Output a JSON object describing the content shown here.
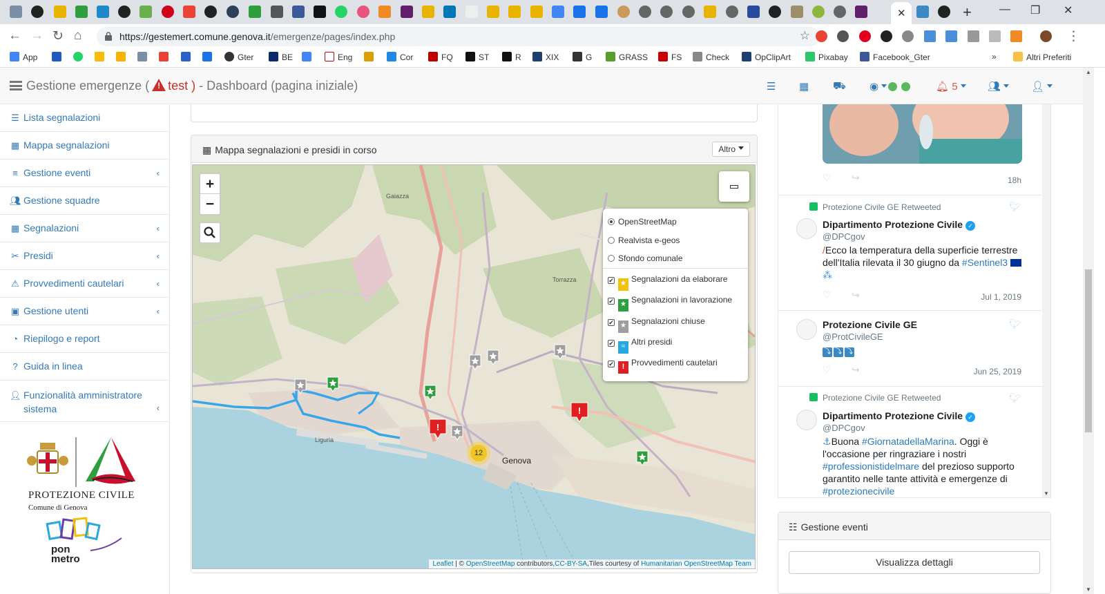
{
  "browser": {
    "url_host": "https://gestemert.comune.genova.it",
    "url_path": "/emergenze/pages/index.php",
    "bookmarks": [
      "App",
      "Gter",
      "BE",
      "Eng",
      "Cor",
      "FQ",
      "ST",
      "R",
      "XIX",
      "G",
      "GRASS",
      "FS",
      "Check",
      "OpClipArt",
      "Pixabay",
      "Facebook_Gter",
      "Altri Preferiti"
    ]
  },
  "header": {
    "title_prefix": "Gestione emergenze (",
    "test_label": "test )",
    "title_suffix": "- Dashboard (pagina iniziale)",
    "notifications_count": "5"
  },
  "sidebar": {
    "items": [
      {
        "label": "Lista segnalazioni",
        "icon": "list-icon",
        "sub": false
      },
      {
        "label": "Mappa segnalazioni",
        "icon": "map-icon",
        "sub": false
      },
      {
        "label": "Gestione eventi",
        "icon": "bars-icon",
        "sub": true
      },
      {
        "label": "Gestione squadre",
        "icon": "users-icon",
        "sub": false
      },
      {
        "label": "Segnalazioni",
        "icon": "map-icon",
        "sub": true
      },
      {
        "label": "Presidi",
        "icon": "wrench-icon",
        "sub": true
      },
      {
        "label": "Provvedimenti cautelari",
        "icon": "warning-icon",
        "sub": true
      },
      {
        "label": "Gestione utenti",
        "icon": "id-card-icon",
        "sub": true
      },
      {
        "label": "Riepilogo e report",
        "icon": "pie-chart-icon",
        "sub": false
      },
      {
        "label": "Guida in linea",
        "icon": "question-icon",
        "sub": false
      },
      {
        "label": "Funzionalità amministratore sistema",
        "icon": "user-cog-icon",
        "sub": true
      }
    ],
    "logo_title": "PROTEZIONE CIVILE",
    "logo_subtitle": "Comune di Genova",
    "pon_label_1": "pon",
    "pon_label_2": "metro"
  },
  "map_panel": {
    "title": "Mappa segnalazioni e presidi in corso",
    "dropdown_label": "Altro",
    "base_layers": [
      {
        "label": "OpenStreetMap",
        "selected": true
      },
      {
        "label": "Realvista e-geos",
        "selected": false
      },
      {
        "label": "Sfondo comunale",
        "selected": false
      }
    ],
    "overlays": [
      {
        "label": "Segnalazioni da elaborare",
        "color": "#f0c20c",
        "symbol": "★"
      },
      {
        "label": "Segnalazioni in lavorazione",
        "color": "#2e9e3e",
        "symbol": "★"
      },
      {
        "label": "Segnalazioni chiuse",
        "color": "#9e9e9e",
        "symbol": "★"
      },
      {
        "label": "Altri presidi",
        "color": "#29a8e0",
        "symbol": "≈"
      },
      {
        "label": "Provvedimenti cautelari",
        "color": "#e02020",
        "symbol": "!"
      }
    ],
    "place_labels": [
      "Gaiazza",
      "Torrazza",
      "Liguria"
    ],
    "city_label": "Genova",
    "cluster_count": "12",
    "attribution": {
      "leaflet": "Leaflet",
      "sep": " | © ",
      "osm": "OpenStreetMap",
      "contrib": " contributors,",
      "license": "CC-BY-SA",
      "tiles": ",Tiles courtesy of ",
      "hot": "Humanitarian OpenStreetMap Team"
    }
  },
  "twitter": {
    "first_time": "18h",
    "tweets": [
      {
        "retweet_label": "Protezione Civile GE Retweeted",
        "name": "Dipartimento Protezione Civile",
        "handle": "@DPCgov",
        "text_pre": "Ecco la temperatura della superficie terrestre dell'Italia rilevata il 30 giugno da ",
        "hashtag": "#Sentinel3",
        "time": "Jul 1, 2019"
      },
      {
        "name": "Protezione Civile GE",
        "handle": "@ProtCivileGE",
        "time": "Jun 25, 2019"
      },
      {
        "retweet_label": "Protezione Civile GE Retweeted",
        "name": "Dipartimento Protezione Civile",
        "handle": "@DPCgov",
        "text_1": "Buona ",
        "hashtag_1": "#GiornatadellaMarina",
        "text_2": ". Oggi è l'occasione per ringraziare i nostri ",
        "hashtag_2": "#professionistidelmare",
        "text_3": " del prezioso supporto garantito nelle tante attività e emergenze di ",
        "hashtag_3": "#protezionecivile"
      }
    ]
  },
  "events_panel": {
    "title": "Gestione eventi",
    "button_label": "Visualizza dettagli"
  }
}
